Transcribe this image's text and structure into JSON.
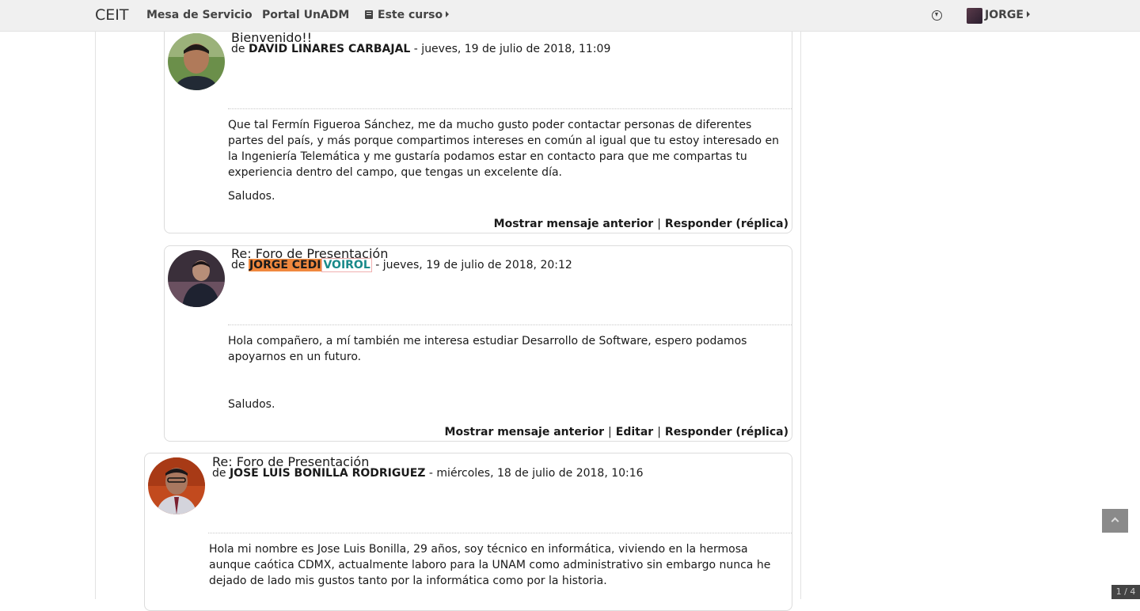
{
  "navbar": {
    "brand": "CEIT",
    "links": [
      "Mesa de Servicio",
      "Portal UnADM",
      "Este curso"
    ],
    "user": "JORGE"
  },
  "posts": [
    {
      "subject": "Bienvenido!!",
      "by": "de",
      "author": "DAVID LINARES CARBAJAL",
      "date": "- jueves, 19 de julio de 2018, 11:09",
      "paragraphs": [
        "Que tal Fermín Figueroa Sánchez, me da mucho gusto poder contactar personas de diferentes partes del país, y más porque compartimos intereses en común al igual que tu estoy interesado en la Ingeniería Telemática y me gustaría podamos estar en contacto para que me compartas tu experiencia dentro del campo, que tengas un excelente día.",
        "Saludos."
      ],
      "actions": [
        "Mostrar mensaje anterior",
        "Responder (réplica)"
      ]
    },
    {
      "subject": "Re: Foro de Presentación",
      "by": "de",
      "author_first": "JORGE CEDI",
      "author_last": "VOIROL",
      "date": "- jueves, 19 de julio de 2018, 20:12",
      "paragraphs": [
        "Hola compañero, a mí también me interesa estudiar Desarrollo de Software, espero podamos apoyarnos en un futuro.",
        "Saludos."
      ],
      "actions": [
        "Mostrar mensaje anterior",
        "Editar",
        "Responder (réplica)"
      ]
    },
    {
      "subject": "Re: Foro de Presentación",
      "by": "de",
      "author": "JOSE LUIS BONILLA RODRIGUEZ",
      "date": "- miércoles, 18 de julio de 2018, 10:16",
      "paragraphs": [
        "Hola mi nombre es Jose Luis Bonilla, 29 años, soy técnico en informática, viviendo en la hermosa aunque caótica CDMX, actualmente laboro para la UNAM como administrativo sin embargo nunca he dejado de lado mis gustos tanto por la informática como por la historia."
      ]
    }
  ],
  "page_counter": "1 / 4"
}
